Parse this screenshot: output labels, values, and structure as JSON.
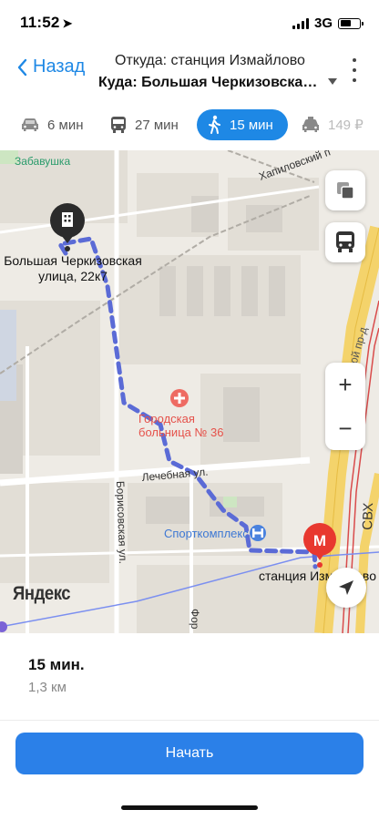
{
  "status": {
    "time": "11:52",
    "network": "3G"
  },
  "header": {
    "back_label": "Назад",
    "from": "Откуда: станция Измайлово",
    "to": "Куда: Большая Черкизовская улица, 22к7"
  },
  "tabs": [
    {
      "mode": "car",
      "icon": "car-icon",
      "label": "6 мин"
    },
    {
      "mode": "bus",
      "icon": "bus-icon",
      "label": "27 мин"
    },
    {
      "mode": "walk",
      "icon": "pedestrian-icon",
      "label": "15 мин",
      "selected": true
    },
    {
      "mode": "taxi",
      "icon": "taxi-icon",
      "label": "149 ₽"
    }
  ],
  "map": {
    "labels": {
      "zabavushka": "Забавушка",
      "hapilovsky": "Хапиловский п",
      "destination": "Большая Черкизовская улица, 22к7",
      "okruzhny": "Окружной пр-д",
      "hospital_line1": "Городская",
      "hospital_line2": "больница № 36",
      "lechebnaya": "Лечебная ул.",
      "borisovskaya": "Борисовская ул.",
      "sport": "Спорткомплекс",
      "svh": "СВХ",
      "station": "станция Измайлово",
      "fort": "Фор",
      "logo": "Яндекс",
      "metro_letter": "М"
    },
    "controls": {
      "zoom_in": "+",
      "zoom_out": "−"
    }
  },
  "route": {
    "duration": "15 мин.",
    "distance": "1,3 км"
  },
  "actions": {
    "start_label": "Начать"
  },
  "colors": {
    "accent": "#1e88e5",
    "route": "#5b6bd6",
    "metro": "#e8382f",
    "start_button": "#2b80e8"
  }
}
